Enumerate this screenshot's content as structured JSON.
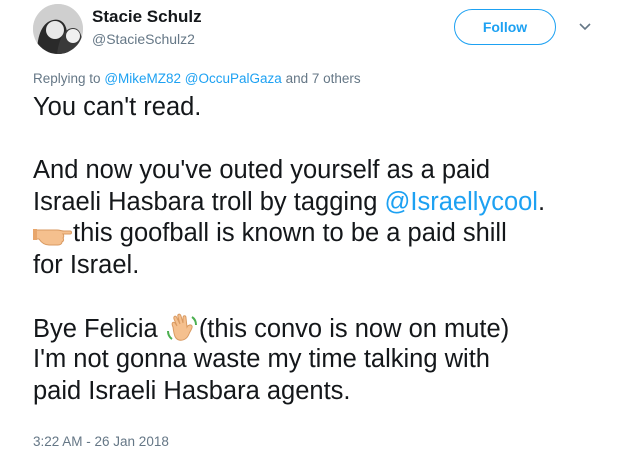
{
  "author": {
    "display_name": "Stacie Schulz",
    "handle": "@StacieSchulz2"
  },
  "actions": {
    "follow_label": "Follow"
  },
  "reply": {
    "prefix": "Replying to",
    "mentions": [
      "@MikeMZ82",
      "@OccuPalGaza"
    ],
    "suffix": "and 7 others"
  },
  "tweet": {
    "line1": "You can't read.",
    "line2": "And now you've outed yourself as a paid",
    "line3_text": "Israeli Hasbara troll by tagging",
    "line3_mention": "@Israellycool",
    "line3_end": ".",
    "line4_text": "this goofball is known to be a paid shill",
    "line5": "for Israel.",
    "line6_before": "Bye Felicia",
    "line6_after": "(this convo is now on mute)",
    "line7": "I'm not gonna waste my time talking with",
    "line8": "paid Israeli Hasbara agents.",
    "emojis": [
      "backhand-index-pointing-right",
      "waving-hand"
    ]
  },
  "timestamp": "3:22 AM - 26 Jan 2018",
  "colors": {
    "accent": "#1da1f2",
    "text": "#14171a",
    "muted": "#657786"
  }
}
